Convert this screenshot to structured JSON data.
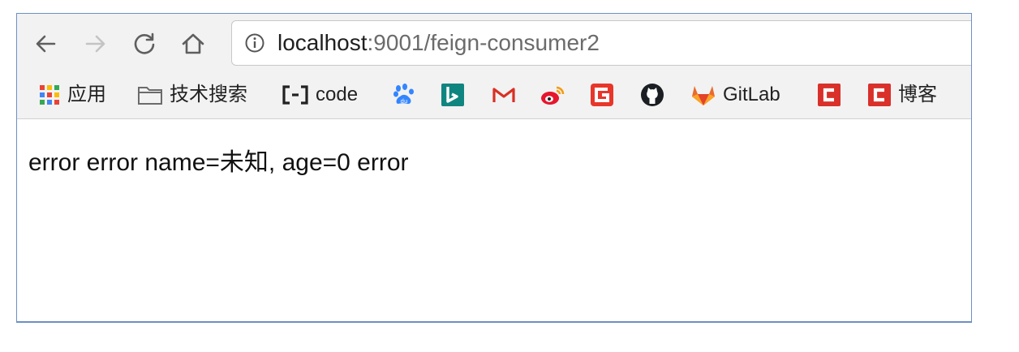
{
  "address_bar": {
    "host": "localhost",
    "path": ":9001/feign-consumer2"
  },
  "bookmarks": [
    {
      "icon": "apps-grid-icon",
      "label": "应用"
    },
    {
      "icon": "folder-icon",
      "label": "技术搜索"
    },
    {
      "icon": "code-brackets-icon",
      "label": "code"
    },
    {
      "icon": "baidu-paw-icon",
      "label": ""
    },
    {
      "icon": "bing-icon",
      "label": ""
    },
    {
      "icon": "gmail-icon",
      "label": ""
    },
    {
      "icon": "weibo-icon",
      "label": ""
    },
    {
      "icon": "g-red-icon",
      "label": ""
    },
    {
      "icon": "github-icon",
      "label": ""
    },
    {
      "icon": "gitlab-icon",
      "label": "GitLab"
    },
    {
      "icon": "csdn-icon",
      "label": ""
    },
    {
      "icon": "csdn-icon",
      "label": "博客"
    }
  ],
  "page": {
    "body_text": "error error name=未知, age=0 error"
  },
  "colors": {
    "window_border": "#6d8fc4",
    "toolbar_bg": "#f2f2f2",
    "csdn_red": "#d9302a",
    "bing_teal": "#0f8580",
    "gitlab_orange": "#e96b2f"
  }
}
